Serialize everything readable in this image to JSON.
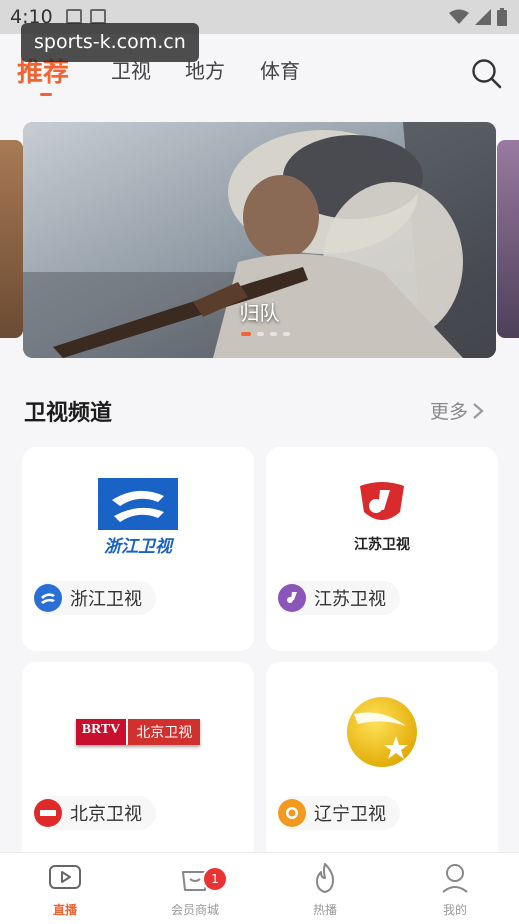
{
  "status_bar": {
    "time": "4:10"
  },
  "watermark": "sports-k.com.cn",
  "top_nav": {
    "tabs": [
      {
        "label": "推荐",
        "active": true
      },
      {
        "label": "卫视",
        "active": false
      },
      {
        "label": "地方",
        "active": false
      },
      {
        "label": "体育",
        "active": false
      }
    ],
    "search_icon": "search-icon"
  },
  "carousel": {
    "caption": "归队",
    "slide_count": 4,
    "active_index": 0
  },
  "section": {
    "title": "卫视频道",
    "more_label": "更多"
  },
  "channels": [
    {
      "name": "浙江卫视",
      "logo_text": "浙江卫视",
      "icon_color": "#1f64c8"
    },
    {
      "name": "江苏卫视",
      "logo_text": "江苏卫视",
      "icon_color": "#8a56b8"
    },
    {
      "name": "北京卫视",
      "logo_text_left": "BRTV",
      "logo_text_right": "北京卫视",
      "icon_color": "#e02a2a"
    },
    {
      "name": "辽宁卫视",
      "icon_color": "#f29a1f"
    }
  ],
  "bottom_nav": {
    "items": [
      {
        "label": "直播",
        "icon": "tv-play-icon",
        "active": true
      },
      {
        "label": "会员商城",
        "icon": "shop-bag-icon",
        "badge": "1"
      },
      {
        "label": "热播",
        "icon": "flame-icon"
      },
      {
        "label": "我的",
        "icon": "profile-icon"
      }
    ]
  },
  "colors": {
    "accent": "#f06433",
    "badge": "#ea3434"
  }
}
